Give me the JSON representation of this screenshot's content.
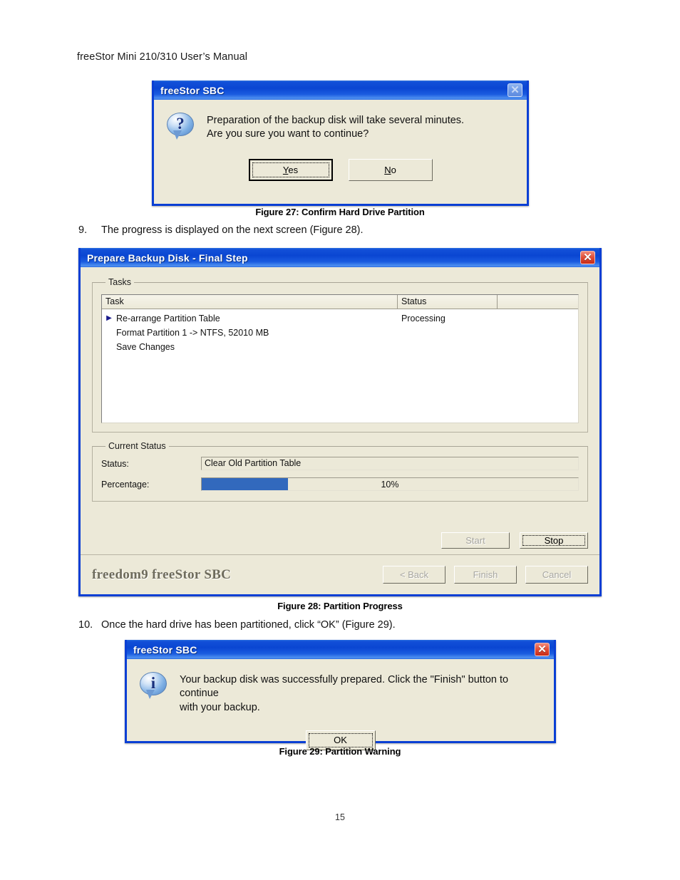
{
  "document": {
    "header": "freeStor Mini 210/310 User’s Manual",
    "page_number": "15",
    "steps": [
      {
        "number": "9.",
        "text": "The progress is displayed on the next screen (Figure 28)."
      },
      {
        "number": "10.",
        "text": "Once the hard drive has been partitioned, click “OK” (Figure 29)."
      }
    ],
    "captions": {
      "fig27": "Figure 27: Confirm Hard Drive Partition",
      "fig28": "Figure 28: Partition Progress",
      "fig29": "Figure 29: Partition Warning"
    }
  },
  "confirm_dialog": {
    "title": "freeStor SBC",
    "icon": "question-bubble-icon",
    "glyph": "?",
    "close_label": "✕",
    "message_line1": "Preparation of the backup disk will take several minutes.",
    "message_line2": "Are you sure you want to continue?",
    "buttons": [
      {
        "label": "Yes",
        "accel": "Y",
        "rest": "es",
        "default": true,
        "disabled": false
      },
      {
        "label": "No",
        "accel": "N",
        "rest": "o",
        "default": false,
        "disabled": false
      }
    ]
  },
  "prepare_window": {
    "title": "Prepare Backup Disk - Final Step",
    "close_label": "✕",
    "tasks_group_label": "Tasks",
    "columns": [
      "Task",
      "Status",
      ""
    ],
    "rows": [
      {
        "marker": "▶",
        "task": "Re-arrange Partition Table",
        "status": "Processing"
      },
      {
        "marker": "",
        "task": "Format Partition 1 -> NTFS, 52010 MB",
        "status": ""
      },
      {
        "marker": "",
        "task": "Save Changes",
        "status": ""
      }
    ],
    "status_group_label": "Current Status",
    "status_label": "Status:",
    "status_value": "Clear Old Partition Table",
    "percentage_label": "Percentage:",
    "percentage_value": "10%",
    "percentage_fill": "23%",
    "progress_color": "#3269bd",
    "action_buttons": [
      {
        "label": "Start",
        "disabled": true,
        "default": false
      },
      {
        "label": "Stop",
        "disabled": false,
        "default": false
      }
    ],
    "brand": "freedom9 freeStor SBC",
    "wizard_buttons": [
      {
        "label": "< Back",
        "accel": "B",
        "disabled": true
      },
      {
        "label": "Finish",
        "accel": "",
        "disabled": true
      },
      {
        "label": "Cancel",
        "accel": "",
        "disabled": true
      }
    ]
  },
  "success_dialog": {
    "title": "freeStor SBC",
    "icon": "info-bubble-icon",
    "glyph": "i",
    "close_label": "✕",
    "message_line1": "Your backup disk was successfully prepared. Click the \"Finish\" button to continue",
    "message_line2": "with your backup.",
    "buttons": [
      {
        "label": "OK",
        "default": true,
        "disabled": false
      }
    ]
  }
}
